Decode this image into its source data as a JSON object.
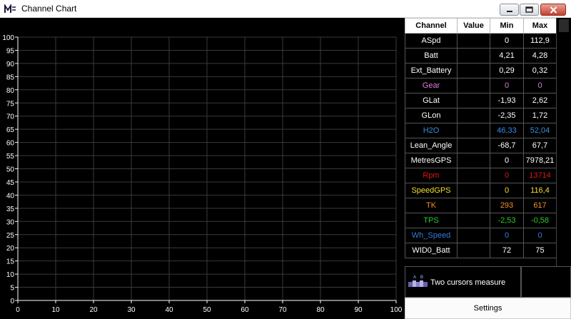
{
  "window": {
    "title": "Channel Chart"
  },
  "chart_data": {
    "type": "line",
    "x": [],
    "series": [],
    "xlim": [
      0,
      100
    ],
    "ylim": [
      0,
      100
    ],
    "xticks": [
      "0",
      "10",
      "20",
      "30",
      "40",
      "50",
      "60",
      "70",
      "80",
      "90",
      "100"
    ],
    "yticks": [
      "0",
      "5",
      "10",
      "15",
      "20",
      "25",
      "30",
      "35",
      "40",
      "45",
      "50",
      "55",
      "60",
      "65",
      "70",
      "75",
      "80",
      "85",
      "90",
      "95",
      "100"
    ],
    "grid": true,
    "background": "#000000",
    "grid_color": "#3a3a3a"
  },
  "table": {
    "headers": [
      "Channel",
      "Value",
      "Min",
      "Max"
    ],
    "rows": [
      {
        "name": "ASpd",
        "value": "",
        "min": "0",
        "max": "112,9",
        "color": "#ffffff"
      },
      {
        "name": "Batt",
        "value": "",
        "min": "4,21",
        "max": "4,28",
        "color": "#ffffff"
      },
      {
        "name": "Ext_Battery",
        "value": "",
        "min": "0,29",
        "max": "0,32",
        "color": "#ffffff"
      },
      {
        "name": "Gear",
        "value": "",
        "min": "0",
        "max": "0",
        "color": "#e07ad8"
      },
      {
        "name": "GLat",
        "value": "",
        "min": "-1,93",
        "max": "2,62",
        "color": "#ffffff"
      },
      {
        "name": "GLon",
        "value": "",
        "min": "-2,35",
        "max": "1,72",
        "color": "#ffffff"
      },
      {
        "name": "H2O",
        "value": "",
        "min": "46,33",
        "max": "52,04",
        "color": "#3a8ee6"
      },
      {
        "name": "Lean_Angle",
        "value": "",
        "min": "-68,7",
        "max": "67,7",
        "color": "#ffffff"
      },
      {
        "name": "MetresGPS",
        "value": "",
        "min": "0",
        "max": "7978,21",
        "color": "#ffffff"
      },
      {
        "name": "Rpm",
        "value": "",
        "min": "0",
        "max": "13714",
        "color": "#e01818"
      },
      {
        "name": "SpeedGPS",
        "value": "",
        "min": "0",
        "max": "116,4",
        "color": "#f2e12a"
      },
      {
        "name": "TK",
        "value": "",
        "min": "293",
        "max": "617",
        "color": "#f0902a"
      },
      {
        "name": "TPS",
        "value": "",
        "min": "-2,53",
        "max": "-0,58",
        "color": "#28d028"
      },
      {
        "name": "Wh_Speed",
        "value": "",
        "min": "0",
        "max": "0",
        "color": "#2f7de0"
      },
      {
        "name": "WID0_Batt",
        "value": "",
        "min": "72",
        "max": "75",
        "color": "#ffffff"
      }
    ]
  },
  "cursor_tool": {
    "label": "Two cursors measure",
    "icon": "two-cursors-icon"
  },
  "settings": {
    "label": "Settings"
  }
}
